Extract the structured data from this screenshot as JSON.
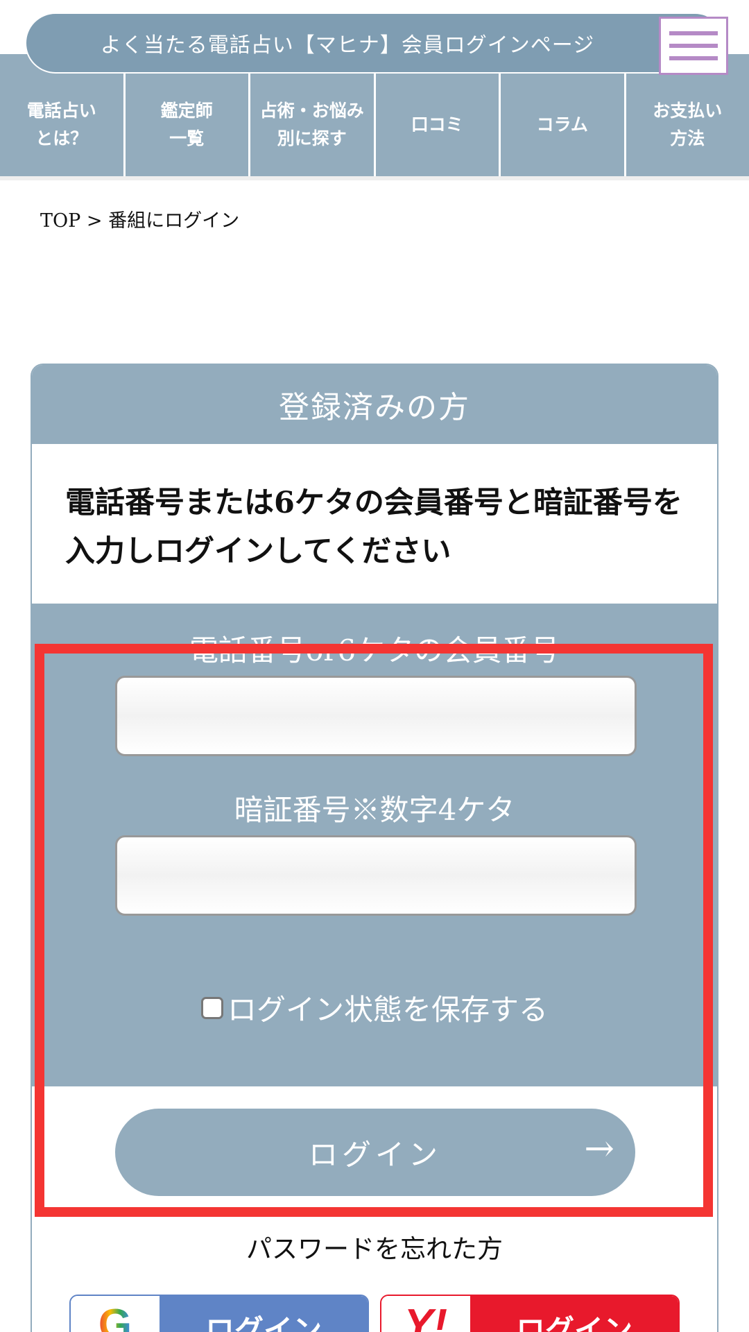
{
  "header": {
    "title": "よく当たる電話占い【マヒナ】会員ログインページ",
    "menu_icon": "hamburger-icon"
  },
  "nav": {
    "items": [
      {
        "label": "電話占い\nとは？"
      },
      {
        "label": "鑑定師\n一覧"
      },
      {
        "label": "占術・お悩み\n別に探す"
      },
      {
        "label": "口コミ"
      },
      {
        "label": "コラム"
      },
      {
        "label": "お支払い\n方法"
      }
    ]
  },
  "breadcrumb": "TOP > 番組にログイン",
  "card": {
    "title": "登録済みの方",
    "instruction": "電話番号または6ケタの会員番号と暗証番号を入力しログインしてください",
    "member_label": "電話番号or6ケタの会員番号",
    "member_value": "",
    "pin_label": "暗証番号※数字4ケタ",
    "pin_value": "",
    "remember_label": "ログイン状態を保存する",
    "remember_checked": false,
    "login_label": "ログイン",
    "login_arrow": "→"
  },
  "forgot": "パスワードを忘れた方",
  "social": {
    "google_icon": "G",
    "google_label": "ログイン",
    "yahoo_icon": "Y!",
    "yahoo_label": "ログイン"
  },
  "colors": {
    "primary": "#93acbd",
    "menu_accent": "#b58ac6",
    "highlight": "#f43533",
    "google": "#5f84c6",
    "yahoo": "#e8192c"
  }
}
